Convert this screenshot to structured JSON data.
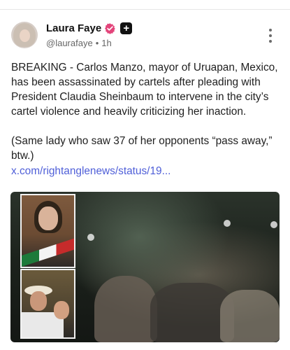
{
  "post": {
    "author_name": "Laura Faye",
    "handle": "@laurafaye",
    "separator": "•",
    "time": "1h",
    "badge_plus": "+",
    "text": "BREAKING - Carlos Manzo, mayor of Uruapan, Mexico, has been assassinated by cartels after pleading with President Claudia Sheinbaum to intervene in the city’s cartel violence and heavily criticizing her inaction.\n\n(Same lady who saw 37 of her opponents “pass away,” btw.)",
    "link": "x.com/rightanglenews/status/19...",
    "icons": {
      "verified": "verified-badge-icon",
      "menu": "more-vertical-icon"
    },
    "colors": {
      "verified": "#e3447a",
      "link": "#4f5fd8",
      "badge": "#111111"
    }
  }
}
